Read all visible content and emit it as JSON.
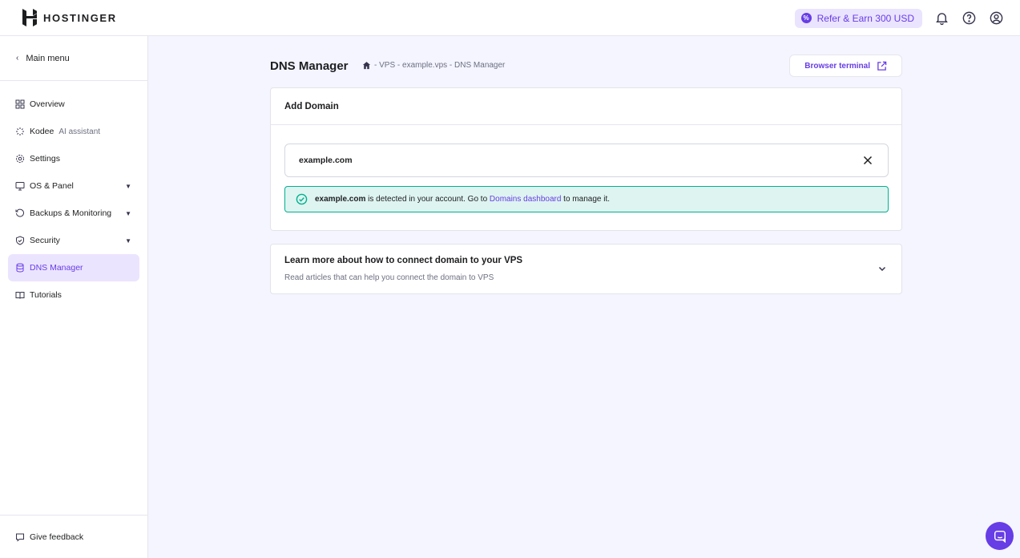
{
  "brand": {
    "name": "HOSTINGER"
  },
  "topbar": {
    "refer_label": "Refer & Earn 300 USD",
    "icons": [
      "bell-icon",
      "help-icon",
      "account-icon"
    ]
  },
  "sidebar": {
    "main_menu": "Main menu",
    "items": [
      {
        "label": "Overview",
        "icon": "overview-icon"
      },
      {
        "label": "Kodee",
        "sub": "AI assistant",
        "icon": "kodee-icon"
      },
      {
        "label": "Settings",
        "icon": "gear-icon"
      },
      {
        "label": "OS & Panel",
        "icon": "monitor-icon",
        "expandable": true
      },
      {
        "label": "Backups & Monitoring",
        "icon": "backup-icon",
        "expandable": true
      },
      {
        "label": "Security",
        "icon": "shield-icon",
        "expandable": true
      },
      {
        "label": "DNS Manager",
        "icon": "dns-icon",
        "active": true
      },
      {
        "label": "Tutorials",
        "icon": "book-icon"
      }
    ],
    "feedback": "Give feedback"
  },
  "page": {
    "title": "DNS Manager",
    "breadcrumb": "- VPS - example.vps - DNS Manager",
    "browser_terminal": "Browser terminal"
  },
  "add_domain": {
    "title": "Add Domain",
    "input_value": "example.com",
    "alert": {
      "domain": "example.com",
      "text_before": " is detected in your account. Go to ",
      "link": "Domains dashboard",
      "text_after": " to manage it."
    }
  },
  "learn": {
    "title": "Learn more about how to connect domain to your VPS",
    "subtitle": "Read articles that can help you connect the domain to VPS"
  },
  "colors": {
    "accent": "#673de6",
    "accent_light": "#ebe4ff",
    "success": "#00b090",
    "success_bg": "#def4f0",
    "page_bg": "#f4f5ff"
  }
}
